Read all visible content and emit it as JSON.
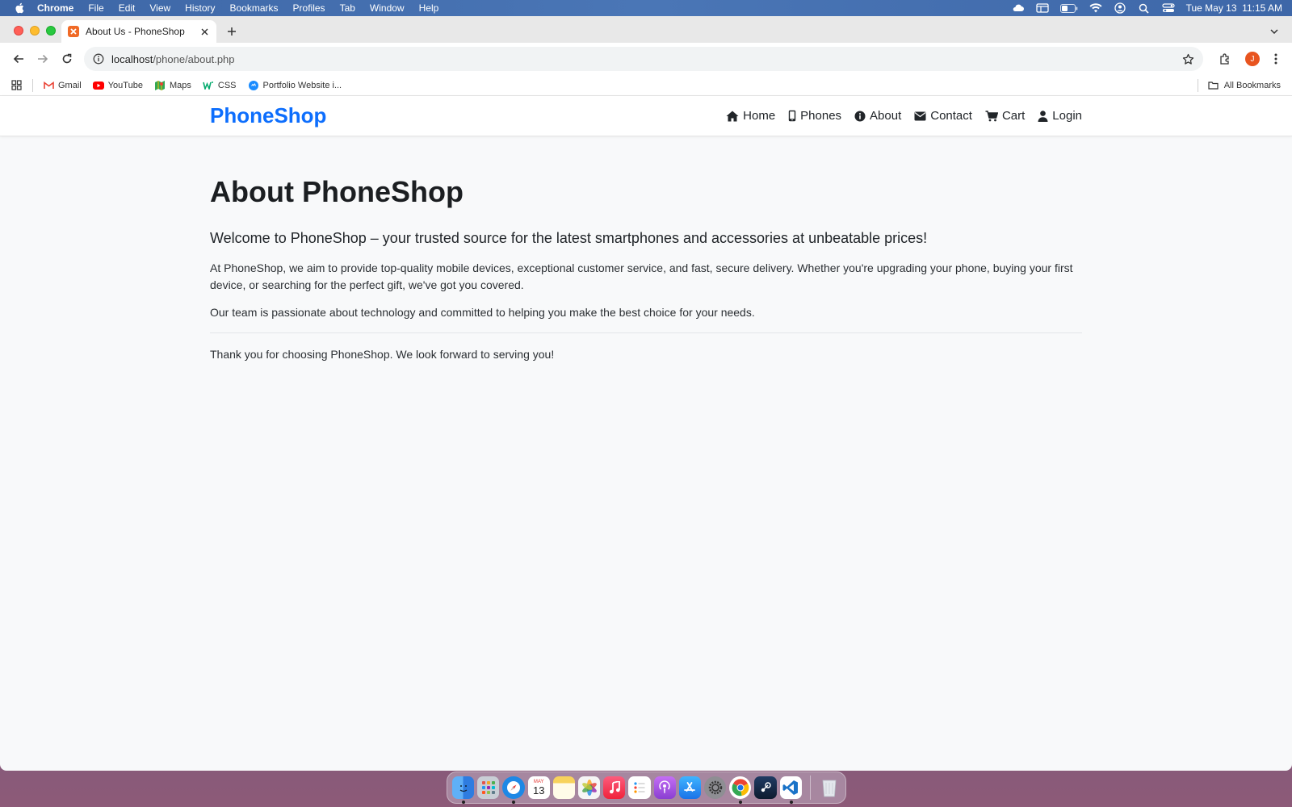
{
  "menubar": {
    "app": "Chrome",
    "items": [
      "File",
      "Edit",
      "View",
      "History",
      "Bookmarks",
      "Profiles",
      "Tab",
      "Window",
      "Help"
    ],
    "clock": "Tue May 13  11:15 AM"
  },
  "browser": {
    "tab_title": "About Us - PhoneShop",
    "url_host": "localhost",
    "url_path": "/phone/about.php",
    "profile_initial": "J",
    "bookmarks": [
      {
        "label": "Gmail",
        "icon": "gmail-icon",
        "color": "#ea4335"
      },
      {
        "label": "YouTube",
        "icon": "youtube-icon",
        "color": "#ff0000"
      },
      {
        "label": "Maps",
        "icon": "maps-icon",
        "color": "#34a853"
      },
      {
        "label": "CSS",
        "icon": "w3schools-icon",
        "color": "#04aa6d"
      },
      {
        "label": "Portfolio Website i...",
        "icon": "portfolio-icon",
        "color": "#1a8cff"
      }
    ],
    "all_bookmarks": "All Bookmarks"
  },
  "site": {
    "brand": "PhoneShop",
    "brand_color": "#0d6efd",
    "nav": [
      {
        "label": "Home",
        "icon": "home-icon"
      },
      {
        "label": "Phones",
        "icon": "phone-icon"
      },
      {
        "label": "About",
        "icon": "info-icon"
      },
      {
        "label": "Contact",
        "icon": "envelope-icon"
      },
      {
        "label": "Cart",
        "icon": "cart-icon"
      },
      {
        "label": "Login",
        "icon": "user-icon"
      }
    ]
  },
  "content": {
    "heading": "About PhoneShop",
    "lead": "Welcome to PhoneShop – your trusted source for the latest smartphones and accessories at unbeatable prices!",
    "para1": "At PhoneShop, we aim to provide top-quality mobile devices, exceptional customer service, and fast, secure delivery. Whether you're upgrading your phone, buying your first device, or searching for the perfect gift, we've got you covered.",
    "para2": "Our team is passionate about technology and committed to helping you make the best choice for your needs.",
    "closing": "Thank you for choosing PhoneShop. We look forward to serving you!"
  },
  "dock": {
    "calendar_month": "MAY",
    "calendar_day": "13",
    "apps": [
      {
        "name": "finder-icon",
        "color": "#3b8cf0"
      },
      {
        "name": "launchpad-icon",
        "color": "#9aa3b0"
      },
      {
        "name": "safari-icon",
        "color": "#1e88e5"
      },
      {
        "name": "calendar-icon",
        "color": "#ffffff"
      },
      {
        "name": "notes-icon",
        "color": "#f7d25c"
      },
      {
        "name": "photos-icon",
        "color": "#f2f2f2"
      },
      {
        "name": "music-icon",
        "color": "#fa2d48"
      },
      {
        "name": "reminders-icon",
        "color": "#ffffff"
      },
      {
        "name": "podcasts-icon",
        "color": "#9b4fd8"
      },
      {
        "name": "app-store-icon",
        "color": "#1a8cff"
      },
      {
        "name": "system-settings-icon",
        "color": "#6e6e73"
      },
      {
        "name": "chrome-icon",
        "color": "#ffffff"
      },
      {
        "name": "steam-icon",
        "color": "#1b2838"
      },
      {
        "name": "vscode-icon",
        "color": "#1a73c8"
      },
      {
        "name": "trash-icon",
        "color": "#d8dde3"
      }
    ]
  }
}
